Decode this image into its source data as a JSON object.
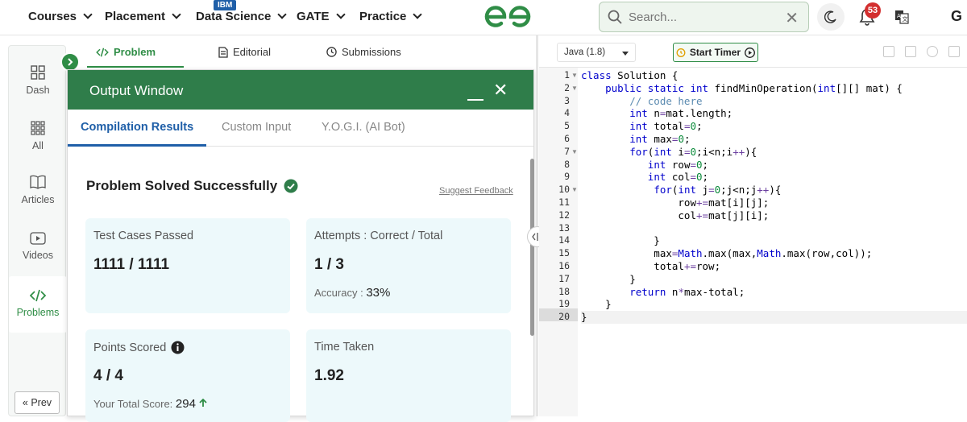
{
  "nav": {
    "items": [
      {
        "label": "Courses"
      },
      {
        "label": "Placement"
      },
      {
        "label": "Data Science"
      },
      {
        "label": "GATE"
      },
      {
        "label": "Practice"
      }
    ],
    "badge": "IBM",
    "search_placeholder": "Search...",
    "notification_count": "53",
    "avatar_letter": "G",
    "brand_color": "#2f8d46"
  },
  "sidebar": {
    "items": [
      {
        "label": "Dash",
        "icon": "dashboard-icon"
      },
      {
        "label": "All",
        "icon": "grid-icon"
      },
      {
        "label": "Articles",
        "icon": "book-icon"
      },
      {
        "label": "Videos",
        "icon": "play-icon"
      },
      {
        "label": "Problems",
        "icon": "code-icon"
      }
    ],
    "prev_label": "« Prev"
  },
  "problem_tabs": [
    {
      "label": "Problem",
      "icon": "code-icon"
    },
    {
      "label": "Editorial",
      "icon": "document-icon"
    },
    {
      "label": "Submissions",
      "icon": "clock-icon"
    }
  ],
  "output": {
    "title": "Output Window",
    "tabs": [
      {
        "label": "Compilation Results"
      },
      {
        "label": "Custom Input"
      },
      {
        "label": "Y.O.G.I. (AI Bot)"
      }
    ],
    "status": "Problem Solved Successfully",
    "feedback_link": "Suggest Feedback",
    "cards": {
      "test_cases": {
        "title": "Test Cases Passed",
        "value": "1111 / 1111"
      },
      "attempts": {
        "title": "Attempts : Correct / Total",
        "value": "1 / 3",
        "sub_label": "Accuracy :",
        "sub_value": "33%"
      },
      "points": {
        "title": "Points Scored",
        "value": "4 / 4",
        "sub_label": "Your Total Score:",
        "sub_value": "294"
      },
      "time": {
        "title": "Time Taken",
        "value": "1.92"
      }
    }
  },
  "editor": {
    "language": "Java (1.8)",
    "timer_label": "Start Timer",
    "line_numbers": [
      "1",
      "2",
      "3",
      "4",
      "5",
      "6",
      "7",
      "8",
      "9",
      "10",
      "11",
      "12",
      "13",
      "14",
      "15",
      "16",
      "17",
      "18",
      "19",
      "20"
    ],
    "code": [
      "class Solution {",
      "    public static int findMinOperation(int[][] mat) {",
      "        // code here",
      "        int n=mat.length;",
      "        int total=0;",
      "        int max=0;",
      "        for(int i=0;i<n;i++){",
      "           int row=0;",
      "           int col=0;",
      "            for(int j=0;j<n;j++){",
      "                row+=mat[i][j];",
      "                col+=mat[j][i];",
      "",
      "            }",
      "            max=Math.max(max,Math.max(row,col));",
      "            total+=row;",
      "        }",
      "        return n*max-total;",
      "    }",
      "}"
    ]
  }
}
